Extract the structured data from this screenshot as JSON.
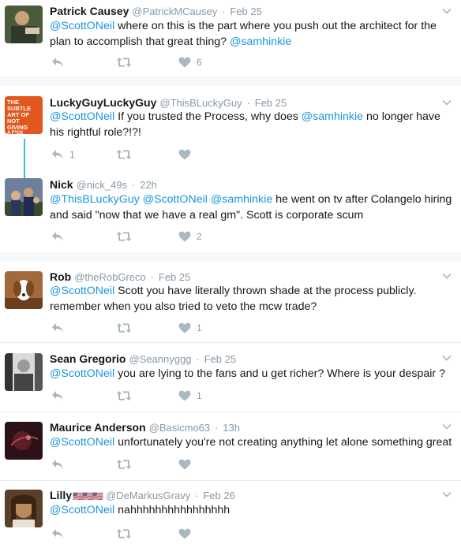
{
  "tweets": [
    {
      "name": "Patrick Causey",
      "handle": "@PatrickMCausey",
      "time": "Feb 25",
      "body": [
        {
          "t": "@ScottONeil",
          "m": true
        },
        {
          "t": " where on this is the part where you push out the architect for the plan to accomplish that great thing? "
        },
        {
          "t": "@samhinkie",
          "m": true
        }
      ],
      "likes": "6",
      "replies": ""
    },
    {
      "name": "LuckyGuyLuckyGuy",
      "handle": "@ThisBLuckyGuy",
      "time": "Feb 25",
      "body": [
        {
          "t": "@ScottONeil",
          "m": true
        },
        {
          "t": " If you trusted the Process, why does "
        },
        {
          "t": "@samhinkie",
          "m": true
        },
        {
          "t": " no longer have his rightful role?!?!"
        }
      ],
      "likes": "",
      "replies": "1",
      "avatar_text": "THE SUBTLE ART OF NOT GIVING A F*CK"
    },
    {
      "name": "Nick",
      "handle": "@nick_49s",
      "time": "22h",
      "body": [
        {
          "t": "@ThisBLuckyGuy",
          "m": true
        },
        {
          "t": " "
        },
        {
          "t": "@ScottONeil",
          "m": true
        },
        {
          "t": " "
        },
        {
          "t": "@samhinkie",
          "m": true
        },
        {
          "t": " he went on tv after Colangelo hiring and said \"now that we have a real gm\". Scott is corporate scum"
        }
      ],
      "likes": "2",
      "replies": ""
    },
    {
      "name": "Rob",
      "handle": "@theRobGreco",
      "time": "Feb 25",
      "body": [
        {
          "t": "@ScottONeil",
          "m": true
        },
        {
          "t": " Scott you have literally thrown shade at the process publicly. remember when you also tried to veto the mcw trade?"
        }
      ],
      "likes": "1",
      "replies": ""
    },
    {
      "name": "Sean Gregorio",
      "handle": "@Seannyggg",
      "time": "Feb 25",
      "body": [
        {
          "t": "@ScottONeil",
          "m": true
        },
        {
          "t": " you are lying to the fans and u get richer? Where is your despair ?"
        }
      ],
      "likes": "1",
      "replies": ""
    },
    {
      "name": "Maurice Anderson",
      "handle": "@Basicmo63",
      "time": "13h",
      "body": [
        {
          "t": "@ScottONeil",
          "m": true
        },
        {
          "t": " unfortunately you're not creating anything let alone something great"
        }
      ],
      "likes": "",
      "replies": ""
    },
    {
      "name": "Lilly",
      "name_flags": "🇺🇸🇺🇸🇺🇸",
      "handle": "@DeMarkusGravy",
      "time": "Feb 26",
      "body": [
        {
          "t": "@ScottONeil",
          "m": true
        },
        {
          "t": " nahhhhhhhhhhhhhhhh"
        }
      ],
      "likes": "",
      "replies": ""
    }
  ],
  "separator": "·",
  "colors": {
    "mention": "#1b95e0",
    "meta": "#8899a6",
    "thread_line": "#3fbbc9",
    "divider": "#e6ecf0"
  },
  "icons": [
    "reply-icon",
    "retweet-icon",
    "like-icon",
    "chevron-down-icon"
  ]
}
